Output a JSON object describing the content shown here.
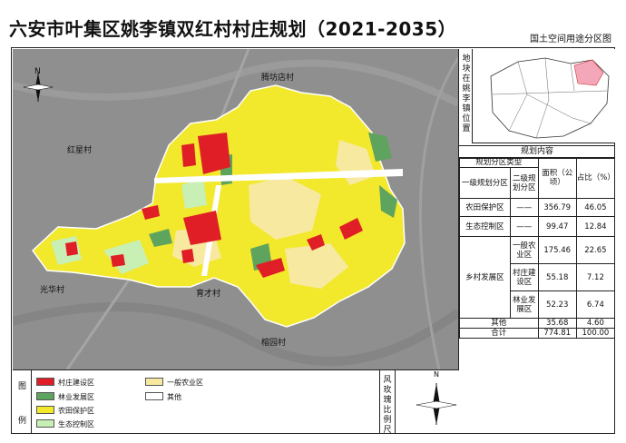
{
  "title": "六安市叶集区姚李镇双红村村庄规划（2021-2035）",
  "subtitle": "国土空间用途分区图",
  "map": {
    "village_labels": [
      "腾坊店村",
      "红星村",
      "光华村",
      "育才村",
      "榕园村"
    ],
    "north_letter": "N"
  },
  "locator": {
    "label": "地块在姚李镇位置"
  },
  "plan_table": {
    "header": "规划内容",
    "group_header": "规划分区类型",
    "columns": [
      "一级规划分区",
      "二级规划分区",
      "面积（公顷）",
      "占比（%）"
    ],
    "rows": [
      {
        "level1": "农田保护区",
        "level2": "——",
        "area": "356.79",
        "pct": "46.05"
      },
      {
        "level1": "生态控制区",
        "level2": "——",
        "area": "99.47",
        "pct": "12.84"
      },
      {
        "level1": "乡村发展区",
        "level2": "一般农业区",
        "area": "175.46",
        "pct": "22.65"
      },
      {
        "level1": "",
        "level2": "村庄建设区",
        "area": "55.18",
        "pct": "7.12"
      },
      {
        "level1": "",
        "level2": "林业发展区",
        "area": "52.23",
        "pct": "6.74"
      },
      {
        "level1": "其他",
        "level2": "",
        "area": "35.68",
        "pct": "4.60"
      },
      {
        "level1": "合计",
        "level2": "",
        "area": "774.81",
        "pct": "100.00"
      }
    ]
  },
  "legend": {
    "label_top": "图",
    "label_bottom": "例",
    "items": [
      {
        "label": "村庄建设区",
        "color": "#e01e26"
      },
      {
        "label": "林业发展区",
        "color": "#5ea35e"
      },
      {
        "label": "农田保护区",
        "color": "#f2e82c"
      },
      {
        "label": "生态控制区",
        "color": "#c8f0b4"
      },
      {
        "label": "一般农业区",
        "color": "#f7e9a0"
      },
      {
        "label": "其他",
        "color": "#ffffff"
      }
    ]
  },
  "rose": {
    "label": "风玫瑰比例尺",
    "north_letter": "N"
  }
}
